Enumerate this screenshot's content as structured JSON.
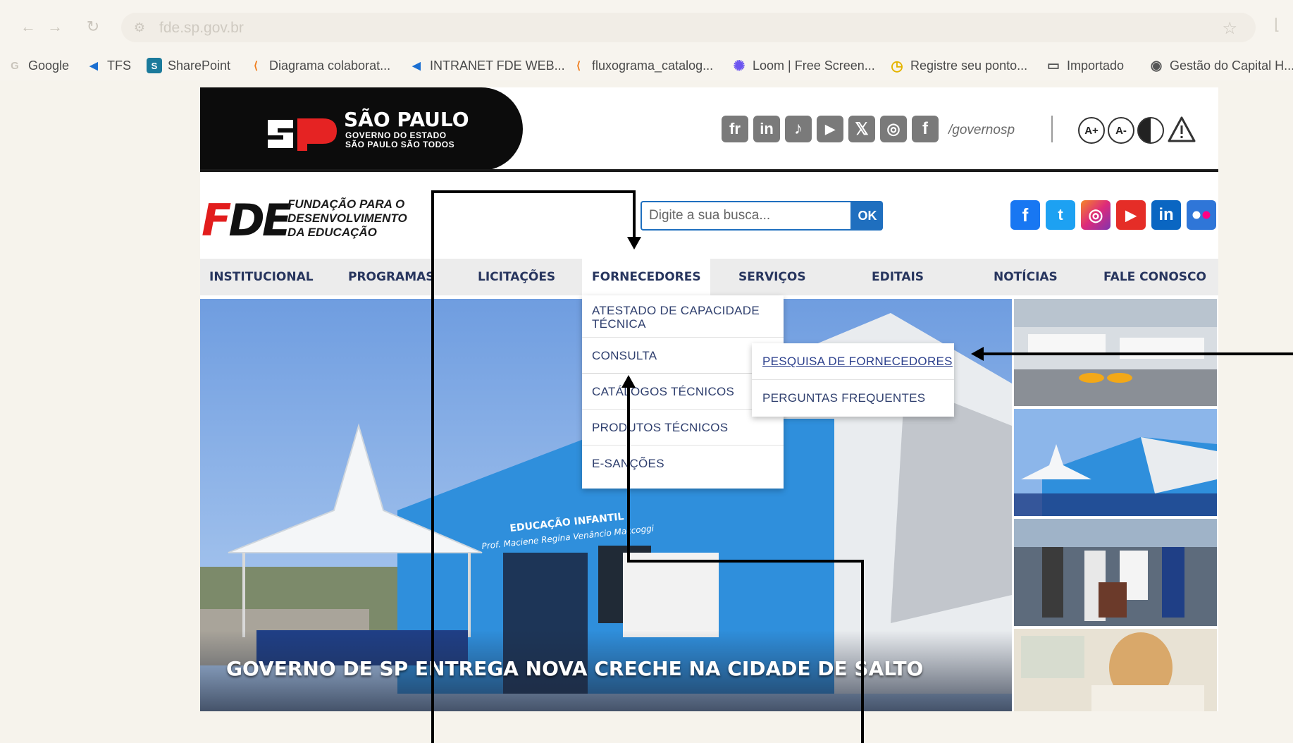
{
  "browser": {
    "url": "fde.sp.gov.br",
    "bookmarks": [
      {
        "label": "Google",
        "icon": "google-icon"
      },
      {
        "label": "TFS",
        "icon": "azure-devops-icon"
      },
      {
        "label": "SharePoint",
        "icon": "sharepoint-icon"
      },
      {
        "label": "Diagrama colaborat...",
        "icon": "lucid-icon"
      },
      {
        "label": "INTRANET FDE WEB...",
        "icon": "azure-devops-icon"
      },
      {
        "label": "fluxograma_catalog...",
        "icon": "lucid-icon"
      },
      {
        "label": "Loom | Free Screen...",
        "icon": "loom-icon"
      },
      {
        "label": "Registre seu ponto...",
        "icon": "clock-icon"
      },
      {
        "label": "Importado",
        "icon": "folder-icon"
      },
      {
        "label": "Gestão do Capital H...",
        "icon": "globe-icon"
      }
    ]
  },
  "gov_header": {
    "title": "SÃO PAULO",
    "subtitle_1": "GOVERNO DO ESTADO",
    "subtitle_2": "SÃO PAULO SÃO TODOS",
    "social_handle": "/governosp",
    "social_icons": [
      "flickr-icon",
      "linkedin-icon",
      "tiktok-icon",
      "youtube-icon",
      "x-icon",
      "instagram-icon",
      "facebook-icon"
    ],
    "accessibility": {
      "increase": "A+",
      "decrease": "A-"
    }
  },
  "fde": {
    "letters": "FDE",
    "name_1": "FUNDAÇÃO PARA O",
    "name_2": "DESENVOLVIMENTO",
    "name_3": "DA EDUCAÇÃO"
  },
  "search": {
    "placeholder": "Digite a sua busca...",
    "button": "OK"
  },
  "social_colored": [
    {
      "icon": "facebook-icon",
      "color": "#1877f2"
    },
    {
      "icon": "twitter-icon",
      "color": "#1da1f2"
    },
    {
      "icon": "instagram-icon",
      "color": "#e1306c"
    },
    {
      "icon": "youtube-icon",
      "color": "#e52d27"
    },
    {
      "icon": "linkedin-icon",
      "color": "#0a66c2"
    },
    {
      "icon": "flickr-icon",
      "color": "#3b82f6"
    }
  ],
  "nav": [
    "INSTITUCIONAL",
    "PROGRAMAS",
    "LICITAÇÕES",
    "FORNECEDORES",
    "SERVIÇOS",
    "EDITAIS",
    "NOTÍCIAS",
    "FALE CONOSCO"
  ],
  "dropdown": {
    "atestado_1": "ATESTADO DE CAPACIDADE",
    "atestado_2": "TÉCNICA",
    "consulta": "CONSULTA",
    "catalogos": "CATÁLOGOS TÉCNICOS",
    "produtos": "PRODUTOS TÉCNICOS",
    "esancoes": "E-SANÇÕES"
  },
  "submenu": {
    "pesquisa": "PESQUISA DE FORNECEDORES",
    "perguntas": "PERGUNTAS FREQUENTES"
  },
  "hero": {
    "caption": "GOVERNO DE SP ENTREGA NOVA CRECHE NA CIDADE DE SALTO",
    "sign_1": "EDUCAÇÃO INFANTIL",
    "sign_2": "Prof. Maciene Regina Venâncio Maccoggi"
  },
  "colors": {
    "nav_text": "#27355e",
    "accent_blue": "#1f6fbf",
    "fde_red": "#e21d1d"
  }
}
